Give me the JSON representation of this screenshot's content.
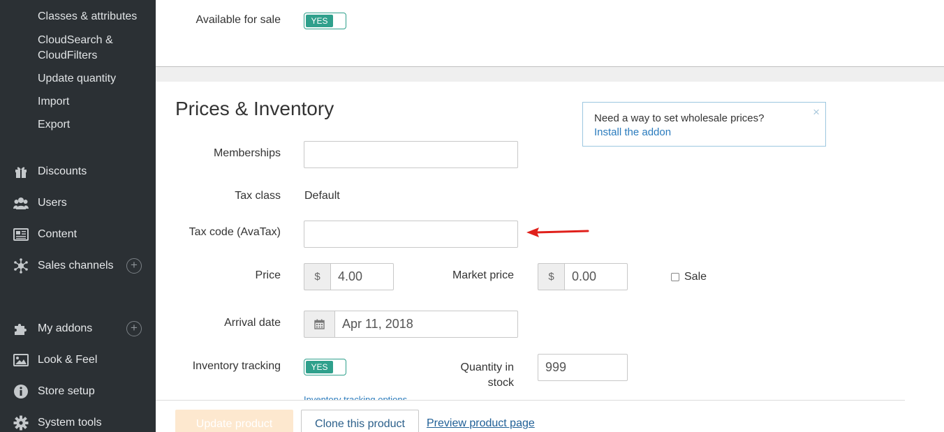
{
  "sidebar": {
    "sub_items": [
      "Classes & attributes",
      "CloudSearch &",
      "CloudFilters",
      "Update quantity",
      "Import",
      "Export"
    ],
    "nav_items": [
      {
        "label": "Discounts",
        "icon": "gift-icon"
      },
      {
        "label": "Users",
        "icon": "users-icon"
      },
      {
        "label": "Content",
        "icon": "newspaper-icon"
      },
      {
        "label": "Sales channels",
        "icon": "network-icon",
        "plus": "+"
      },
      {
        "label": "My addons",
        "icon": "puzzle-icon",
        "plus": "+"
      },
      {
        "label": "Look & Feel",
        "icon": "image-icon"
      },
      {
        "label": "Store setup",
        "icon": "info-icon"
      },
      {
        "label": "System tools",
        "icon": "gear-icon"
      }
    ]
  },
  "top": {
    "available_label": "Available for sale",
    "available_toggle": "YES"
  },
  "prices": {
    "title": "Prices & Inventory",
    "memberships_label": "Memberships",
    "memberships_value": "",
    "tax_class_label": "Tax class",
    "tax_class_value": "Default",
    "tax_code_label": "Tax code (AvaTax)",
    "tax_code_value": "",
    "price_label": "Price",
    "price_currency": "$",
    "price_value": "4.00",
    "market_price_label": "Market price",
    "market_currency": "$",
    "market_value": "0.00",
    "sale_label": "Sale",
    "arrival_label": "Arrival date",
    "arrival_value": "Apr 11, 2018",
    "inventory_label": "Inventory tracking",
    "inventory_toggle": "YES",
    "inventory_options": "Inventory tracking options",
    "quantity_label_1": "Quantity in",
    "quantity_label_2": "stock",
    "quantity_value": "999"
  },
  "tip": {
    "text": "Need a way to set wholesale prices?",
    "link": "Install the addon",
    "close": "×"
  },
  "footer": {
    "update_button": "Update product",
    "clone_button": "Clone this product",
    "preview_link": "Preview product page"
  },
  "colors": {
    "sidebar_bg": "#2b3034",
    "toggle_green": "#2fa08c",
    "arrow_red": "#e0201b",
    "link_blue": "#2a7bbd"
  }
}
